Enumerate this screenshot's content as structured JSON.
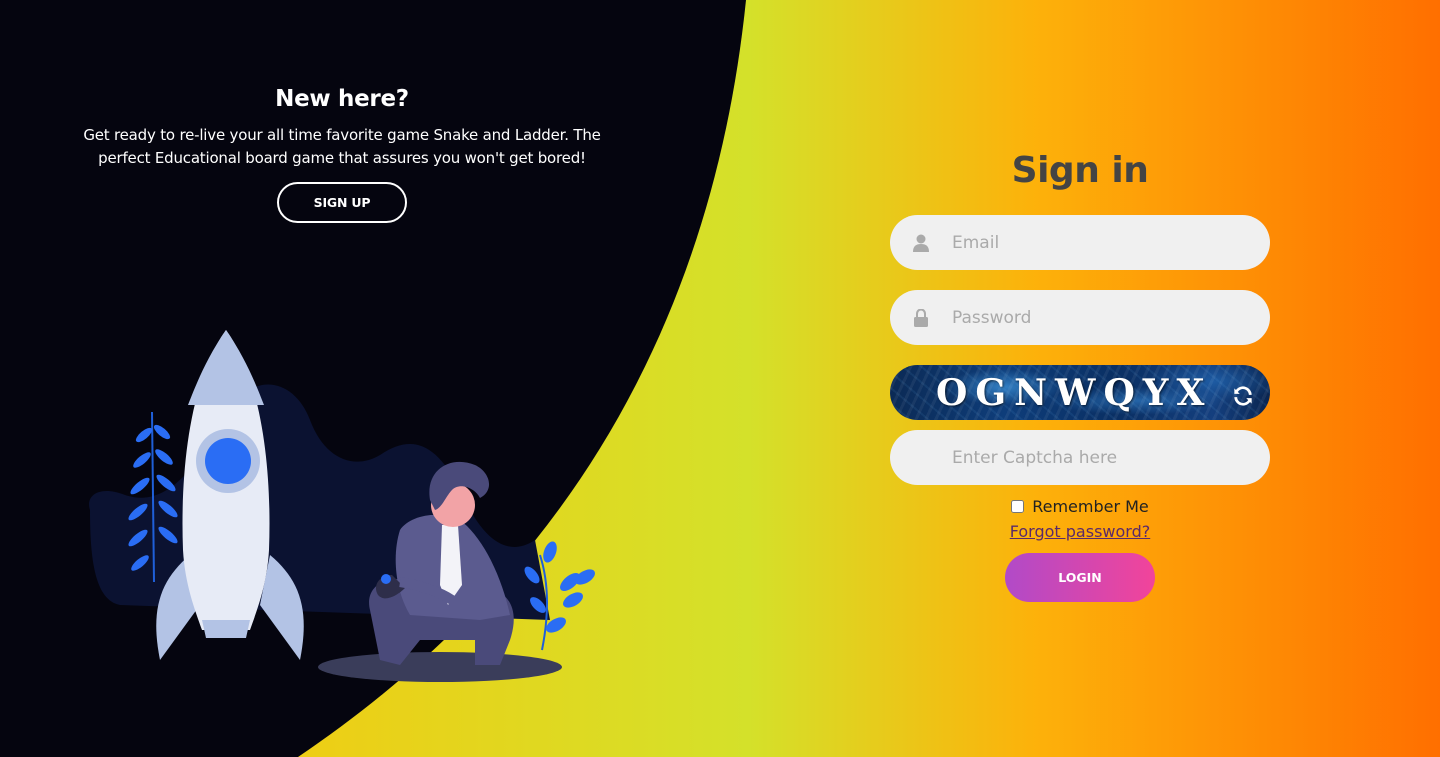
{
  "left_panel": {
    "title": "New here?",
    "description": "Get ready to re-live your all time favorite game Snake and Ladder. The perfect Educational board game that assures you won't get bored!",
    "signup_label": "SIGN UP"
  },
  "signin": {
    "title": "Sign in",
    "email_placeholder": "Email",
    "password_placeholder": "Password",
    "captcha_text": "OGNWQYX",
    "captcha_placeholder": "Enter Captcha here",
    "remember_label": "Remember Me",
    "forgot_label": "Forgot password?",
    "login_label": "LOGIN"
  },
  "icons": {
    "email": "user-icon",
    "password": "lock-icon",
    "captcha_refresh": "refresh-icon"
  },
  "colors": {
    "dark_panel": "#05050f",
    "gradient_left": "#ffc107",
    "gradient_mid": "#d4e12a",
    "gradient_right": "#ff6f00",
    "login_start": "#b14ac8",
    "login_end": "#f2449a",
    "title": "#444444"
  }
}
